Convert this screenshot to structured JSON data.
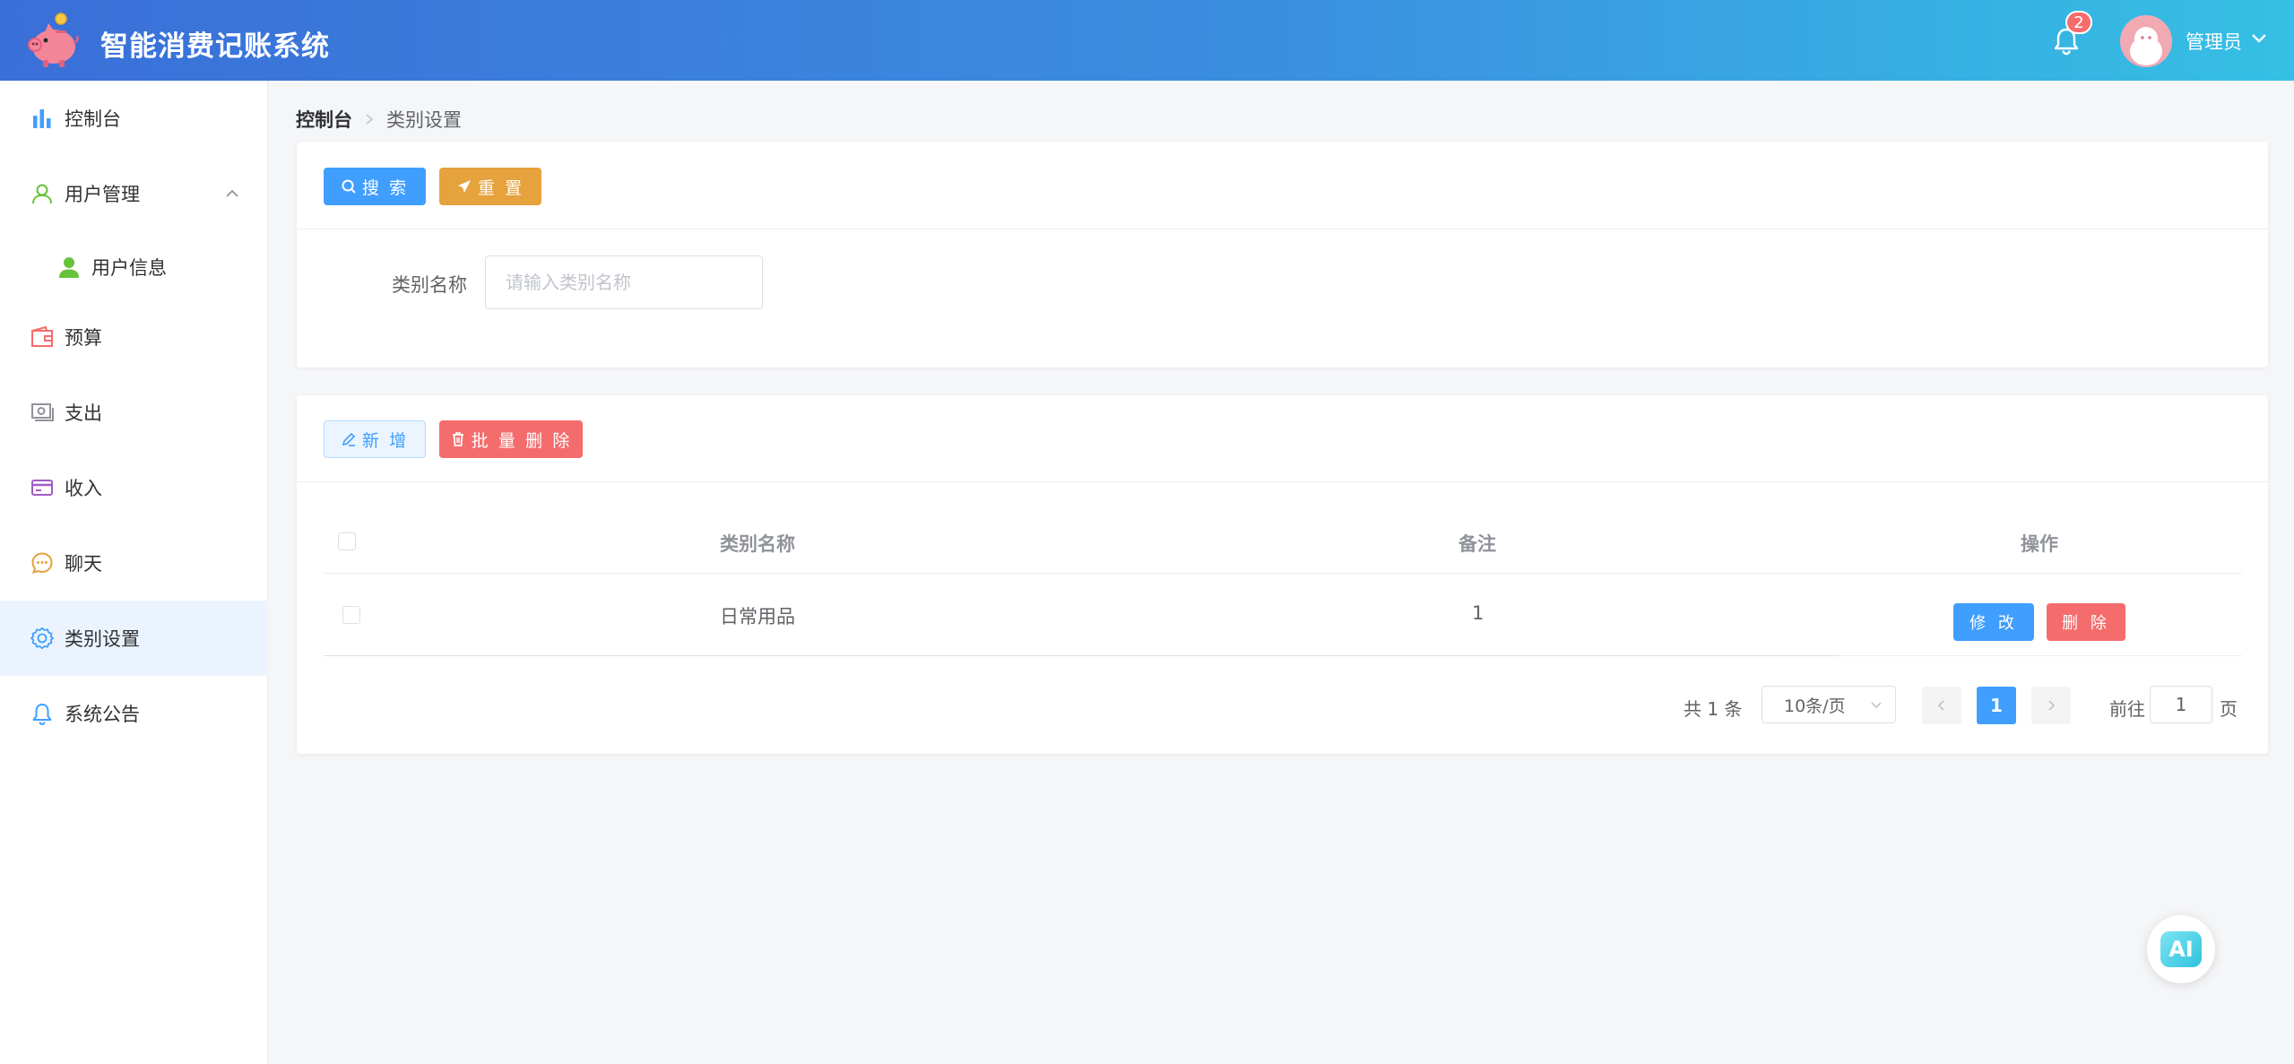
{
  "app": {
    "title": "智能消费记账系统"
  },
  "header": {
    "notification_count": "2",
    "user_name": "管理员"
  },
  "sidebar": {
    "items": [
      {
        "label": "控制台",
        "icon": "bar-chart-icon",
        "color": "#409eff"
      },
      {
        "label": "用户管理",
        "icon": "user-outline-icon",
        "color": "#67c23a",
        "expanded": true
      },
      {
        "label": "用户信息",
        "icon": "user-solid-icon",
        "color": "#67c23a"
      },
      {
        "label": "预算",
        "icon": "wallet-icon",
        "color": "#f56c6c"
      },
      {
        "label": "支出",
        "icon": "money-icon",
        "color": "#909399"
      },
      {
        "label": "收入",
        "icon": "credit-card-icon",
        "color": "#a05bc5"
      },
      {
        "label": "聊天",
        "icon": "chat-dots-icon",
        "color": "#e6a23c"
      },
      {
        "label": "类别设置",
        "icon": "setting-icon",
        "color": "#409eff",
        "active": true
      },
      {
        "label": "系统公告",
        "icon": "bell-icon",
        "color": "#409eff"
      }
    ]
  },
  "breadcrumb": {
    "root": "控制台",
    "current": "类别设置"
  },
  "search": {
    "search_label": "搜 索",
    "reset_label": "重 置",
    "field_label": "类别名称",
    "field_placeholder": "请输入类别名称"
  },
  "toolbar": {
    "add_label": "新 增",
    "batch_delete_label": "批 量 删 除"
  },
  "table": {
    "columns": [
      "类别名称",
      "备注",
      "操作"
    ],
    "rows": [
      {
        "name": "日常用品",
        "note": "1",
        "edit_label": "修 改",
        "delete_label": "删 除"
      }
    ]
  },
  "pagination": {
    "total_text": "共 1 条",
    "page_size": "10条/页",
    "current_page": "1",
    "goto_label": "前往",
    "goto_value": "1",
    "goto_unit": "页"
  },
  "ai_button": {
    "label": "AI"
  }
}
